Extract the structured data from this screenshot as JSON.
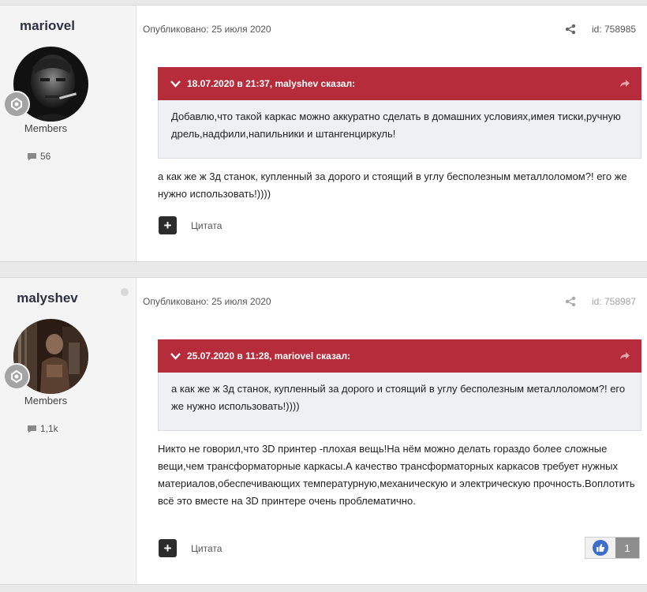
{
  "posts": [
    {
      "author": "mariovel",
      "group": "Members",
      "post_count": "56",
      "published": "Опубликовано: 25 июля 2020",
      "post_id": "id: 758985",
      "quote_header": "18.07.2020 в 21:37, malyshev сказал:",
      "quote_text": "Добавлю,что такой каркас можно аккуратно сделать в домашних условиях,имея тиски,ручную дрель,надфили,напильники и штангенциркуль!",
      "body_text": "а как же ж 3д станок, купленный за дорого и стоящий в углу бесполезным металлоломом?! его же нужно использовать!))))",
      "multiquote_label": "+",
      "quote_button": "Цитата"
    },
    {
      "author": "malyshev",
      "group": "Members",
      "post_count": "1,1k",
      "published": "Опубликовано: 25 июля 2020",
      "post_id": "id: 758987",
      "quote_header": "25.07.2020 в 11:28, mariovel сказал:",
      "quote_text": "а как же ж 3д станок, купленный за дорого и стоящий в углу бесполезным металлоломом?! его же нужно использовать!))))",
      "body_text": "Никто не говорил,что 3D принтер -плохая вещь!На нём можно делать гораздо более сложные вещи,чем трансформаторные каркасы.А качество трансформаторных каркасов требует нужных материалов,обеспечивающих температурную,механическую и электрическую прочность.Воплотить всё это вместе на 3D принтере очень проблематично.",
      "multiquote_label": "+",
      "quote_button": "Цитата",
      "reaction_count": "1"
    }
  ],
  "colors": {
    "quote_header": "#b72c3a",
    "sidebar": "#f4f4f5",
    "reaction_like": "#3b6fc9"
  },
  "icons": [
    "chevron-down-icon",
    "reply-arrow-icon",
    "share-icon",
    "comment-icon",
    "rank-badge-icon",
    "like-icon"
  ]
}
